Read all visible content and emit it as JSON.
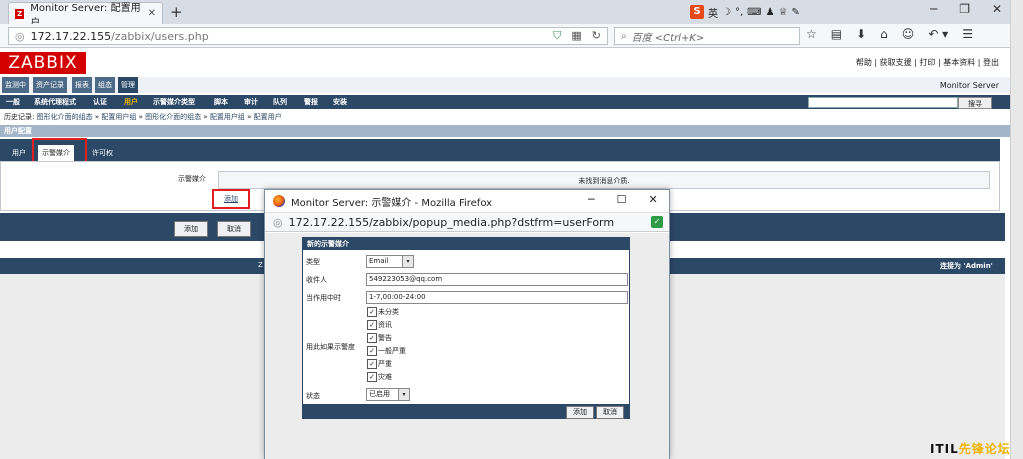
{
  "browser": {
    "tab_title": "Monitor Server: 配置用户",
    "new_tab": "+",
    "url_host": "172.17.22.155",
    "url_path": "/zabbix/users.php",
    "search_placeholder": "百度 <Ctrl+K>",
    "ime_label": "英",
    "favicon_letter": "Z"
  },
  "zabbix": {
    "logo": "ZABBIX",
    "top_links": "帮助 | 获取支援 | 打印 | 基本资料 | 登出",
    "server_name": "Monitor Server",
    "main_menu": [
      "监测中",
      "资产记录",
      "报表",
      "组态",
      "管理"
    ],
    "sub_menu": [
      "一般",
      "系统代理程式",
      "认证",
      "用户",
      "示警媒介类型",
      "脚本",
      "审计",
      "队列",
      "警报",
      "安装"
    ],
    "search_button": "搜寻",
    "history_label": "历史记录:",
    "history_items": [
      "图形化介面的组态",
      "配置用户组",
      "图形化介面的组态",
      "配置用户组",
      "配置用户"
    ],
    "history_sep": "»",
    "form_title": "用户配置",
    "form_tabs": [
      "用户",
      "示警媒介",
      "许可权"
    ],
    "media_label": "示警媒介",
    "no_media": "未找到消息介质.",
    "add_link": "添加",
    "add_button": "添加",
    "cancel_button": "取消",
    "footer_left": "Z",
    "logged_in": "连接为 'Admin'"
  },
  "popup": {
    "title": "Monitor Server: 示警媒介 - Mozilla Firefox",
    "url": "172.17.22.155/zabbix/popup_media.php?dstfrm=userForm",
    "form_title": "新的示警媒介",
    "type_label": "类型",
    "type_value": "Email",
    "sendto_label": "收件人",
    "sendto_value": "549223053@qq.com",
    "period_label": "当作用中时",
    "period_value": "1-7,00:00-24:00",
    "severity_label": "用此如果示警度",
    "severities": [
      "未分类",
      "资讯",
      "警告",
      "一般严重",
      "严重",
      "灾难"
    ],
    "status_label": "状态",
    "status_value": "已启用",
    "add_button": "添加",
    "cancel_button": "取消"
  },
  "watermark": {
    "part1": "ITIL",
    "part2": "先锋论坛"
  }
}
